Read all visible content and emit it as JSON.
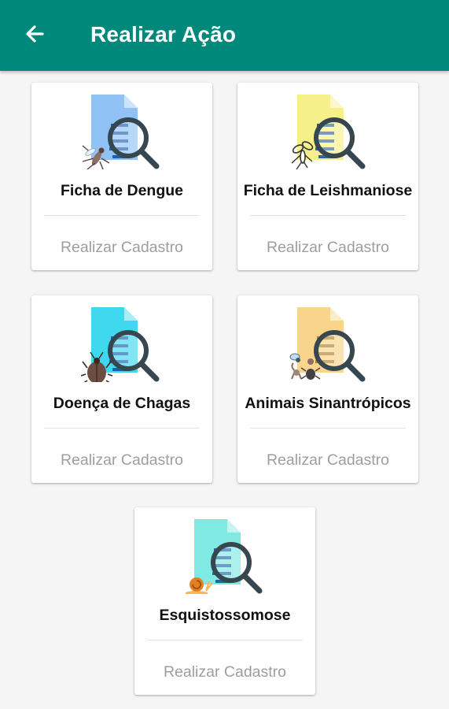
{
  "header": {
    "title": "Realizar Ação"
  },
  "cards": [
    {
      "title": "Ficha de Dengue",
      "action": "Realizar Cadastro",
      "doc_color": "#90c2f5",
      "critter_icon": "mosquito-icon"
    },
    {
      "title": "Ficha de Leishmaniose",
      "action": "Realizar Cadastro",
      "doc_color": "#f7f08a",
      "critter_icon": "sandfly-icon"
    },
    {
      "title": "Doença de Chagas",
      "action": "Realizar Cadastro",
      "doc_color": "#3fd8ee",
      "critter_icon": "kissing-bug-icon"
    },
    {
      "title": "Animais Sinantrópicos",
      "action": "Realizar Cadastro",
      "doc_color": "#f8d58a",
      "critter_icon": "synanthropic-animals-icon"
    },
    {
      "title": "Esquistossomose",
      "action": "Realizar Cadastro",
      "doc_color": "#7fe9e2",
      "critter_icon": "snail-icon"
    }
  ]
}
